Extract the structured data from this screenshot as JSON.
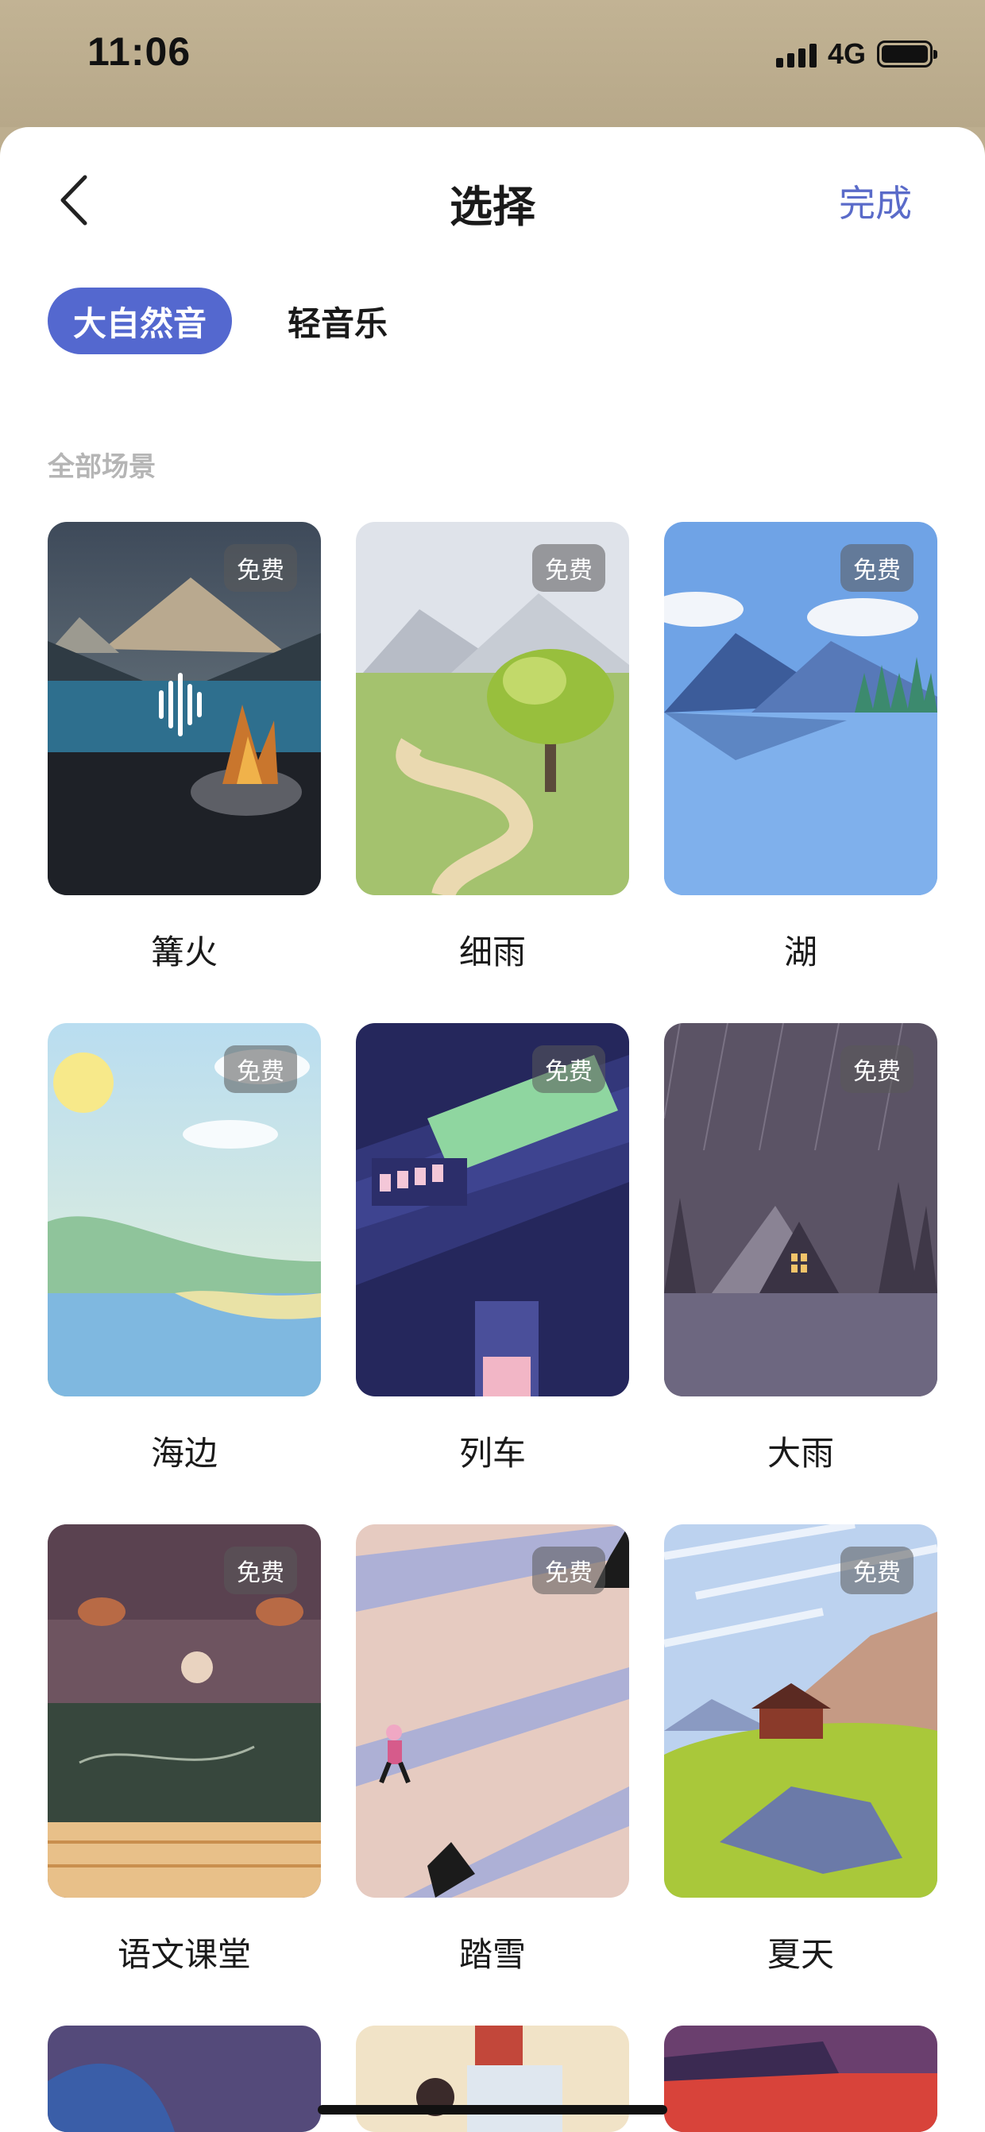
{
  "status_bar": {
    "time": "11:06",
    "network": "4G"
  },
  "header": {
    "title": "选择",
    "done_label": "完成"
  },
  "tabs": [
    {
      "label": "大自然音",
      "active": true
    },
    {
      "label": "轻音乐",
      "active": false
    }
  ],
  "section_title": "全部场景",
  "badge_label": "免费",
  "scenes": [
    {
      "label": "篝火",
      "badge": "免费",
      "playing": true
    },
    {
      "label": "细雨",
      "badge": "免费"
    },
    {
      "label": "湖",
      "badge": "免费"
    },
    {
      "label": "海边",
      "badge": "免费"
    },
    {
      "label": "列车",
      "badge": "免费"
    },
    {
      "label": "大雨",
      "badge": "免费"
    },
    {
      "label": "语文课堂",
      "badge": "免费"
    },
    {
      "label": "踏雪",
      "badge": "免费"
    },
    {
      "label": "夏天",
      "badge": "免费"
    }
  ],
  "colors": {
    "accent": "#5468cf",
    "done": "#5a6bc9",
    "status_bar_bg": "#bdae8f"
  }
}
